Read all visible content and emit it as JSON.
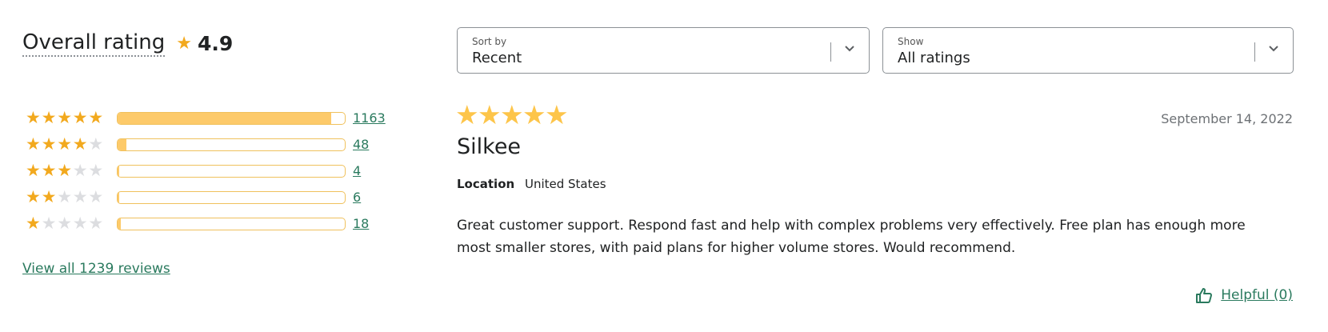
{
  "summary": {
    "overall_label": "Overall rating",
    "star_icon": "star-icon",
    "rating": "4.9",
    "view_all": "View all 1239 reviews"
  },
  "distribution": [
    {
      "stars": 5,
      "count": "1163",
      "fraction": 0.94
    },
    {
      "stars": 4,
      "count": "48",
      "fraction": 0.039
    },
    {
      "stars": 3,
      "count": "4",
      "fraction": 0.003
    },
    {
      "stars": 2,
      "count": "6",
      "fraction": 0.005
    },
    {
      "stars": 1,
      "count": "18",
      "fraction": 0.015
    }
  ],
  "filters": {
    "sort": {
      "label": "Sort by",
      "value": "Recent"
    },
    "show": {
      "label": "Show",
      "value": "All ratings"
    }
  },
  "review": {
    "stars": 5,
    "date": "September 14, 2022",
    "reviewer": "Silkee",
    "location_label": "Location",
    "location_value": "United States",
    "text": "Great customer support. Respond fast and help with complex problems very effectively. Free plan has enough more most smaller stores, with paid plans for higher volume stores. Would recommend.",
    "helpful": "Helpful (0)"
  },
  "colors": {
    "star": "#f2a91e",
    "bar_fill": "#fdca6a",
    "link": "#2a7a5e"
  }
}
